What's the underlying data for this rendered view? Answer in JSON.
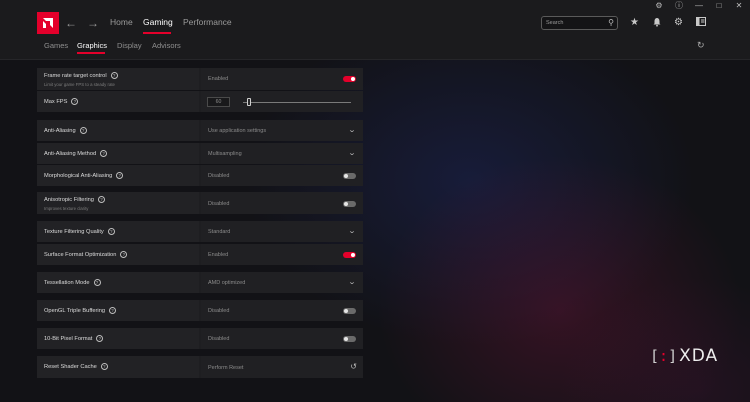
{
  "titlebar": {
    "icons": [
      "bug-icon",
      "help-icon",
      "minimize-icon",
      "maximize-icon",
      "close-icon"
    ]
  },
  "header": {
    "nav": [
      {
        "label": "Home",
        "active": false
      },
      {
        "label": "Gaming",
        "active": true
      },
      {
        "label": "Performance",
        "active": false
      }
    ],
    "search_placeholder": "Search",
    "icons": [
      "star-icon",
      "bell-icon",
      "gear-icon",
      "layout-icon"
    ]
  },
  "subtabs": [
    {
      "label": "Games",
      "active": false
    },
    {
      "label": "Graphics",
      "active": true
    },
    {
      "label": "Display",
      "active": false
    },
    {
      "label": "Advisors",
      "active": false
    }
  ],
  "settings": {
    "frame_rate": {
      "label": "Frame rate target control",
      "sub": "Limit your game FPS to a steady rate",
      "value": "Enabled",
      "on": true
    },
    "max_fps": {
      "label": "Max FPS",
      "value": "60",
      "slider_fraction": 0.06
    },
    "anti_aliasing": {
      "label": "Anti-Aliasing",
      "value": "Use application settings"
    },
    "anti_aliasing_method": {
      "label": "Anti-Aliasing Method",
      "value": "Multisampling"
    },
    "morphological_aa": {
      "label": "Morphological Anti-Aliasing",
      "value": "Disabled",
      "on": false
    },
    "anisotropic": {
      "label": "Anisotropic Filtering",
      "sub": "Improves texture clarity",
      "value": "Disabled",
      "on": false
    },
    "texture_quality": {
      "label": "Texture Filtering Quality",
      "value": "Standard"
    },
    "surface_format": {
      "label": "Surface Format Optimization",
      "value": "Enabled",
      "on": true
    },
    "tessellation": {
      "label": "Tessellation Mode",
      "value": "AMD optimized"
    },
    "opengl_triple": {
      "label": "OpenGL Triple Buffering",
      "value": "Disabled",
      "on": false
    },
    "ten_bit": {
      "label": "10-Bit Pixel Format",
      "value": "Disabled",
      "on": false
    },
    "shader_cache": {
      "label": "Reset Shader Cache",
      "value": "Perform Reset"
    }
  },
  "watermark": {
    "text": "XDA"
  },
  "colors": {
    "accent": "#e4002b",
    "panel": "#1e1e21",
    "header": "#1b1b1d"
  }
}
